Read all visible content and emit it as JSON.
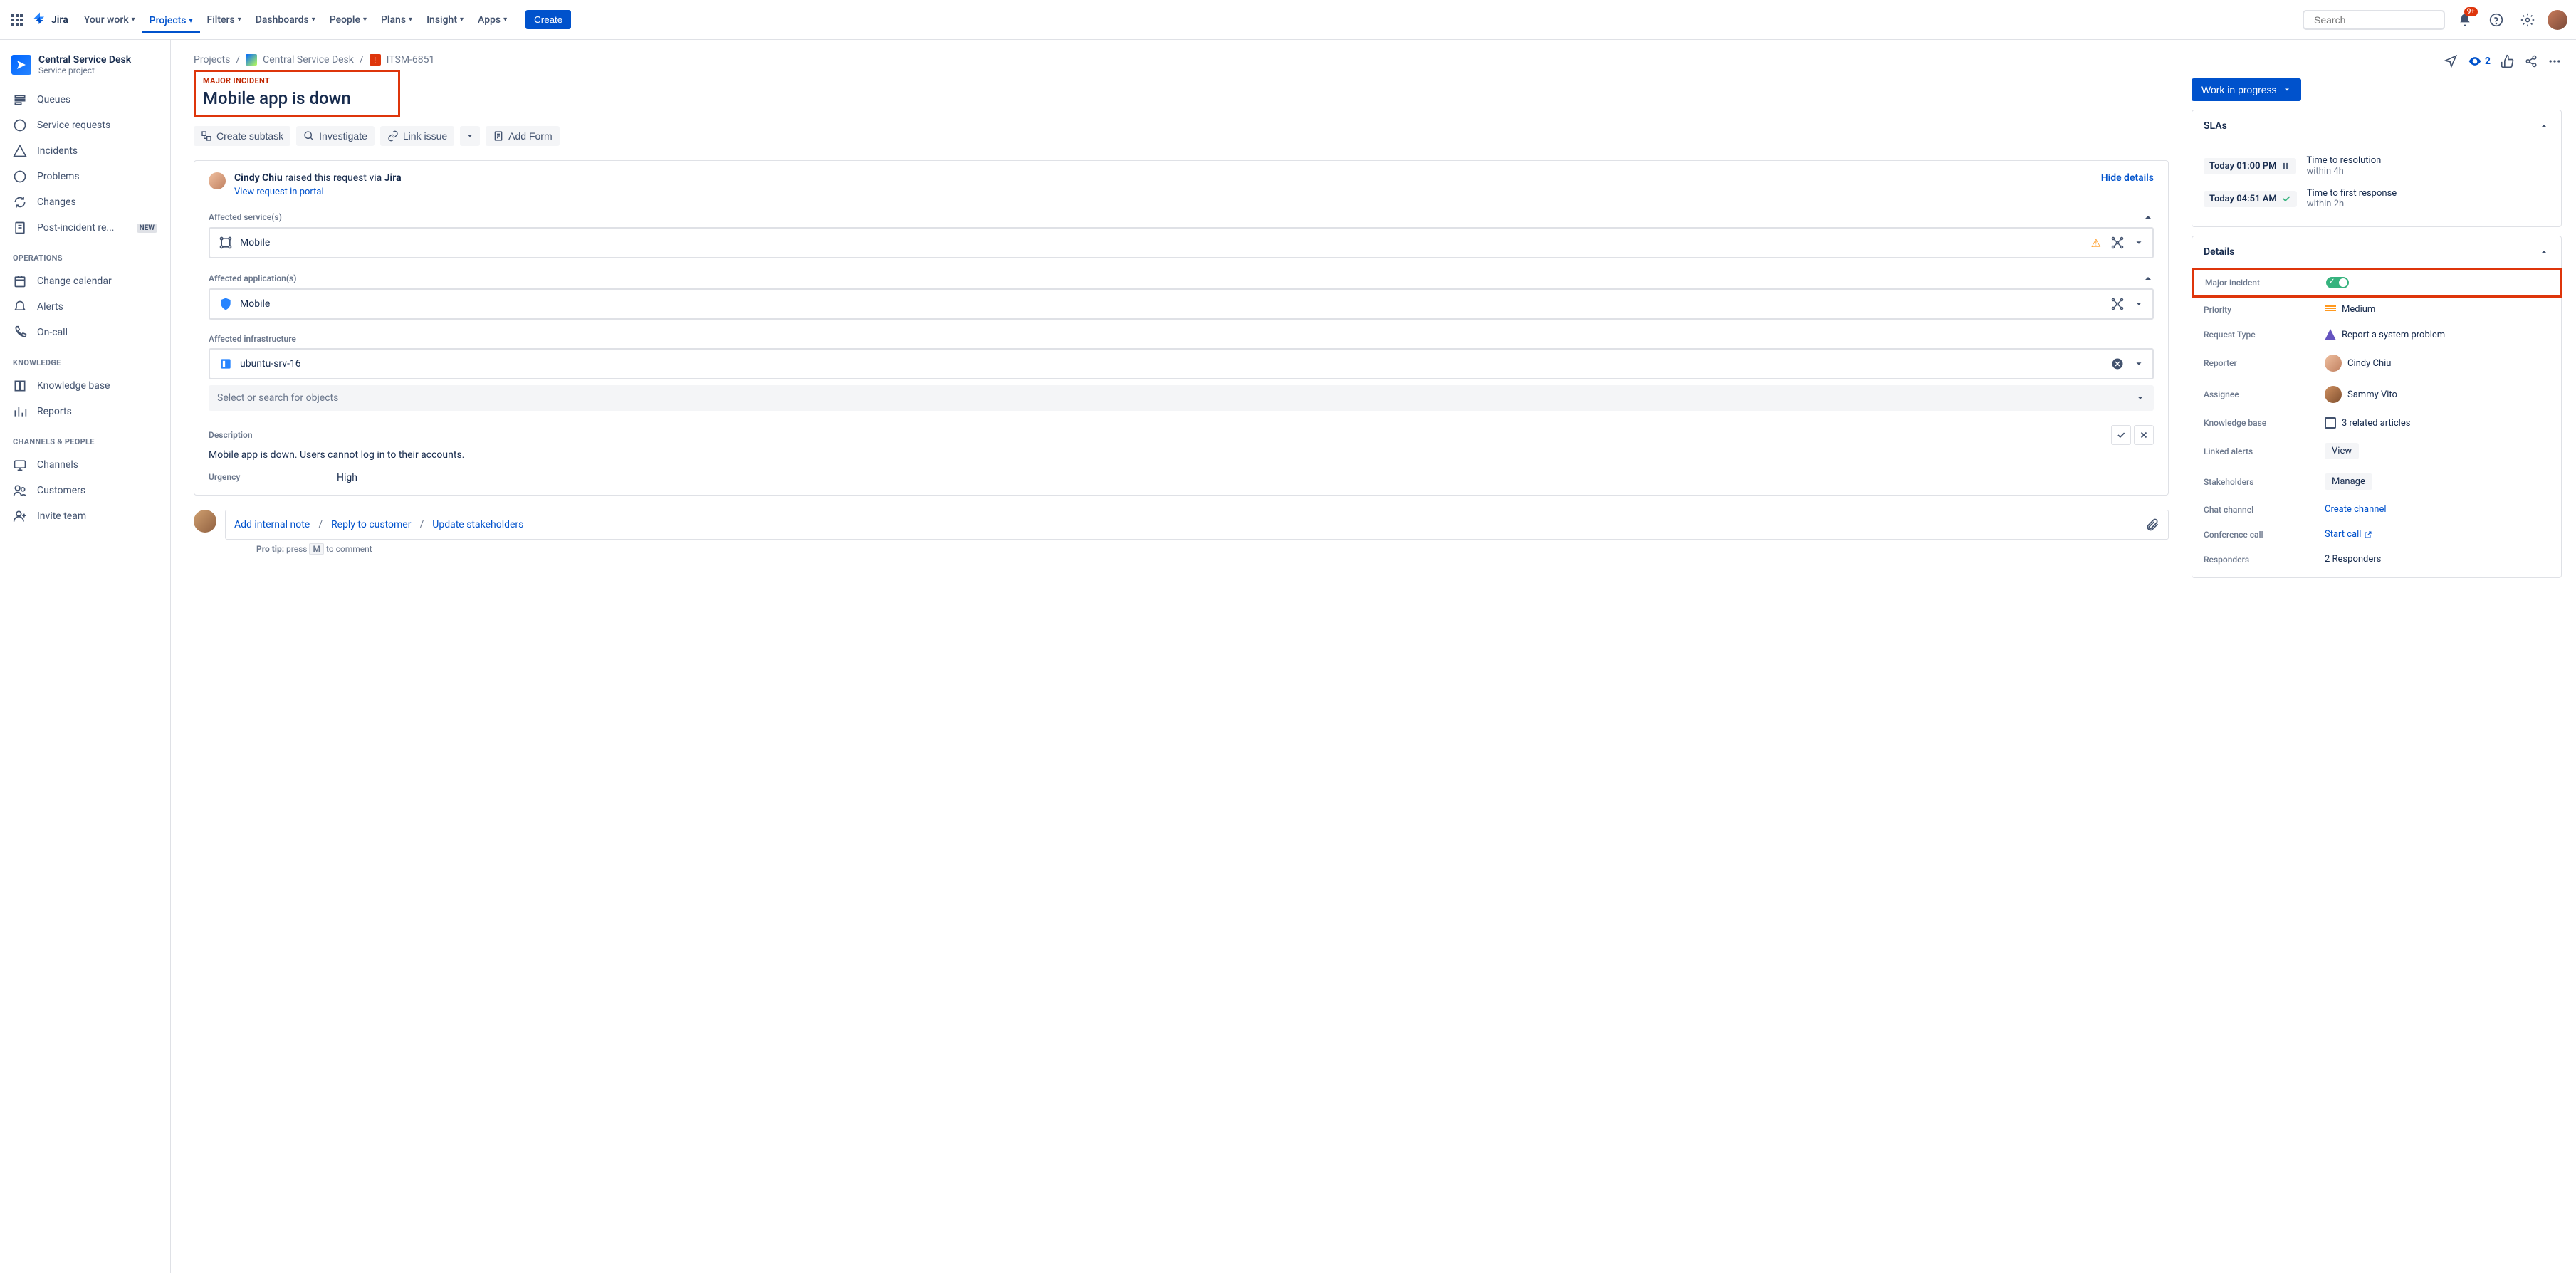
{
  "topnav": {
    "logo": "Jira",
    "items": [
      "Your work",
      "Projects",
      "Filters",
      "Dashboards",
      "People",
      "Plans",
      "Insight",
      "Apps"
    ],
    "active_index": 1,
    "create": "Create",
    "search_placeholder": "Search",
    "notif_badge": "9+"
  },
  "sidebar": {
    "project_name": "Central Service Desk",
    "project_type": "Service project",
    "items_main": [
      "Queues",
      "Service requests",
      "Incidents",
      "Problems",
      "Changes",
      "Post-incident re..."
    ],
    "new_badge": "NEW",
    "section_ops": "OPERATIONS",
    "items_ops": [
      "Change calendar",
      "Alerts",
      "On-call"
    ],
    "section_know": "KNOWLEDGE",
    "items_know": [
      "Knowledge base",
      "Reports"
    ],
    "section_ch": "CHANNELS & PEOPLE",
    "items_ch": [
      "Channels",
      "Customers",
      "Invite team"
    ]
  },
  "breadcrumb": {
    "projects": "Projects",
    "project": "Central Service Desk",
    "issue": "ITSM-6851"
  },
  "issue": {
    "major_tag": "MAJOR INCIDENT",
    "title": "Mobile app is down",
    "actions": {
      "subtask": "Create subtask",
      "investigate": "Investigate",
      "link": "Link issue",
      "form": "Add Form"
    },
    "requester": "Cindy Chiu",
    "requester_via": " raised this request via ",
    "requester_src": "Jira",
    "portal_link": "View request in portal",
    "hide_details": "Hide details",
    "fields": {
      "affected_services_label": "Affected service(s)",
      "affected_services_value": "Mobile",
      "affected_apps_label": "Affected application(s)",
      "affected_apps_value": "Mobile",
      "affected_infra_label": "Affected infrastructure",
      "affected_infra_value": "ubuntu-srv-16",
      "search_placeholder": "Select or search for objects",
      "description_label": "Description",
      "description_value": "Mobile app is down. Users cannot log in to their accounts.",
      "urgency_label": "Urgency",
      "urgency_value": "High"
    },
    "comment": {
      "note": "Add internal note",
      "reply": "Reply to customer",
      "update": "Update stakeholders",
      "protip_label": "Pro tip:",
      "protip_press": " press ",
      "protip_key": "M",
      "protip_rest": " to comment"
    }
  },
  "right": {
    "watch_count": "2",
    "status": "Work in progress",
    "slas": {
      "header": "SLAs",
      "rows": [
        {
          "chip": "Today 01:00 PM",
          "icon": "pause",
          "title": "Time to resolution",
          "sub": "within 4h"
        },
        {
          "chip": "Today 04:51 AM",
          "icon": "check",
          "title": "Time to first response",
          "sub": "within 2h"
        }
      ]
    },
    "details": {
      "header": "Details",
      "rows": [
        {
          "k": "Major incident",
          "type": "toggle"
        },
        {
          "k": "Priority",
          "type": "priority",
          "v": "Medium"
        },
        {
          "k": "Request Type",
          "type": "rtype",
          "v": "Report a system problem"
        },
        {
          "k": "Reporter",
          "type": "user",
          "v": "Cindy Chiu",
          "av": "av1"
        },
        {
          "k": "Assignee",
          "type": "user",
          "v": "Sammy Vito",
          "av": "av2"
        },
        {
          "k": "Knowledge base",
          "type": "kb",
          "v": "3 related articles"
        },
        {
          "k": "Linked alerts",
          "type": "pill",
          "v": "View"
        },
        {
          "k": "Stakeholders",
          "type": "pill",
          "v": "Manage"
        },
        {
          "k": "Chat channel",
          "type": "link",
          "v": "Create channel"
        },
        {
          "k": "Conference call",
          "type": "linkext",
          "v": "Start call"
        },
        {
          "k": "Responders",
          "type": "text",
          "v": "2 Responders"
        }
      ]
    }
  }
}
